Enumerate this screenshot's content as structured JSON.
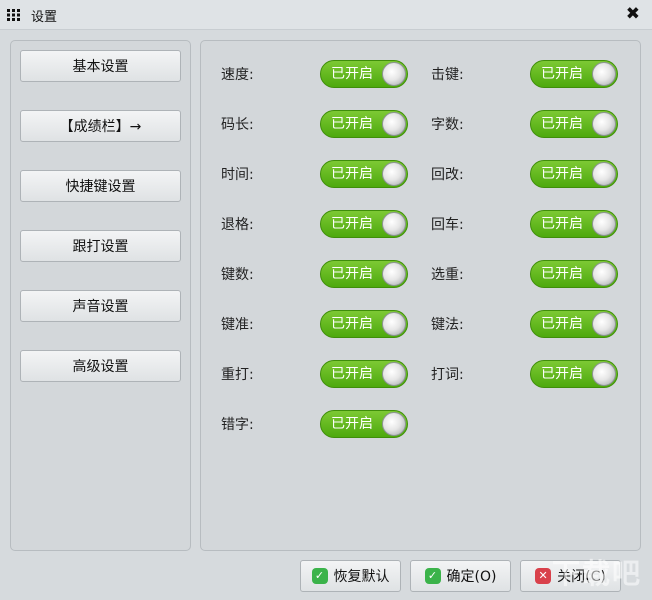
{
  "window": {
    "title": "设置",
    "close_glyph": "✖"
  },
  "nav": [
    {
      "label": "基本设置"
    },
    {
      "label": "【成绩栏】→"
    },
    {
      "label": "快捷键设置"
    },
    {
      "label": "跟打设置"
    },
    {
      "label": "声音设置"
    },
    {
      "label": "高级设置"
    }
  ],
  "toggle_text": "已开启",
  "options": [
    {
      "label": "速度:",
      "state": "已开启"
    },
    {
      "label": "击键:",
      "state": "已开启"
    },
    {
      "label": "码长:",
      "state": "已开启"
    },
    {
      "label": "字数:",
      "state": "已开启"
    },
    {
      "label": "时间:",
      "state": "已开启"
    },
    {
      "label": "回改:",
      "state": "已开启"
    },
    {
      "label": "退格:",
      "state": "已开启"
    },
    {
      "label": "回车:",
      "state": "已开启"
    },
    {
      "label": "键数:",
      "state": "已开启"
    },
    {
      "label": "选重:",
      "state": "已开启"
    },
    {
      "label": "键准:",
      "state": "已开启"
    },
    {
      "label": "键法:",
      "state": "已开启"
    },
    {
      "label": "重打:",
      "state": "已开启"
    },
    {
      "label": "打词:",
      "state": "已开启"
    },
    {
      "label": "错字:",
      "state": "已开启"
    }
  ],
  "footer": {
    "restore_label": "恢复默认",
    "ok_label": "确定(O)",
    "close_label": "关闭(C)"
  },
  "watermark": "下载吧",
  "colors": {
    "toggle_on": "#5cb81c",
    "ok_icon": "#3bb34a",
    "close_icon": "#d9414b"
  }
}
